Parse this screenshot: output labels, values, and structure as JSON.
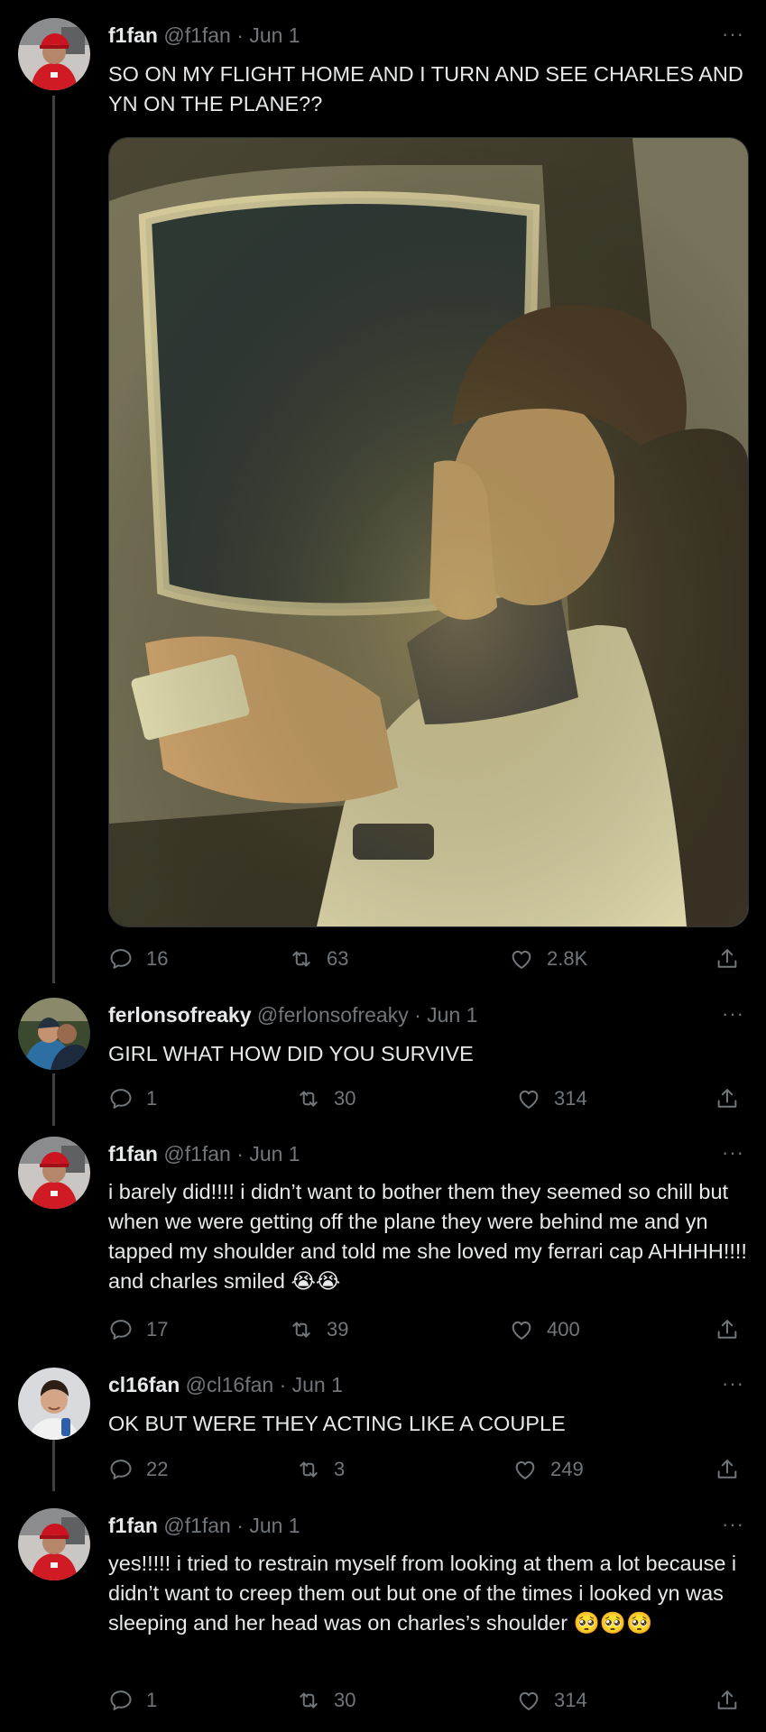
{
  "tweets": [
    {
      "name": "f1fan",
      "handle": "@f1fan",
      "date": "Jun 1",
      "text": "SO ON MY FLIGHT HOME AND I TURN AND SEE CHARLES AND YN ON THE PLANE??",
      "replies": "16",
      "retweets": "63",
      "likes": "2.8K",
      "avatar": "ferrari-fan-avatar"
    },
    {
      "name": "ferlonsofreaky",
      "handle": "@ferlonsofreaky",
      "date": "Jun 1",
      "text": "GIRL WHAT HOW DID YOU SURVIVE",
      "replies": "1",
      "retweets": "30",
      "likes": "314",
      "avatar": "drivers-hug-avatar"
    },
    {
      "name": "f1fan",
      "handle": "@f1fan",
      "date": "Jun 1",
      "text": "i barely did!!!! i didn’t want to bother them they seemed so chill but when we were getting off the plane they were behind me and yn tapped my shoulder and told me she loved my ferrari cap AHHHH!!!! and charles smiled 😭😭",
      "replies": "17",
      "retweets": "39",
      "likes": "400",
      "avatar": "ferrari-fan-avatar"
    },
    {
      "name": "cl16fan",
      "handle": "@cl16fan",
      "date": "Jun 1",
      "text": "OK BUT WERE THEY ACTING LIKE A COUPLE",
      "replies": "22",
      "retweets": "3",
      "likes": "249",
      "avatar": "driver-portrait-avatar"
    },
    {
      "name": "f1fan",
      "handle": "@f1fan",
      "date": "Jun 1",
      "text": "yes!!!!! i tried to restrain myself from looking  at them a lot because i didn’t want to creep them out but one of the times i looked yn was sleeping and her head was on charles’s shoulder 🥺🥺🥺",
      "replies": "1",
      "retweets": "30",
      "likes": "314",
      "avatar": "ferrari-fan-avatar"
    }
  ],
  "ui": {
    "more": "···",
    "dot": "·"
  },
  "colors": {
    "background": "#000000",
    "text": "#e7e9ea",
    "muted": "#71767b",
    "thread_line": "#3e4144"
  },
  "icons": [
    "reply-icon",
    "retweet-icon",
    "like-icon",
    "share-icon",
    "more-icon"
  ]
}
